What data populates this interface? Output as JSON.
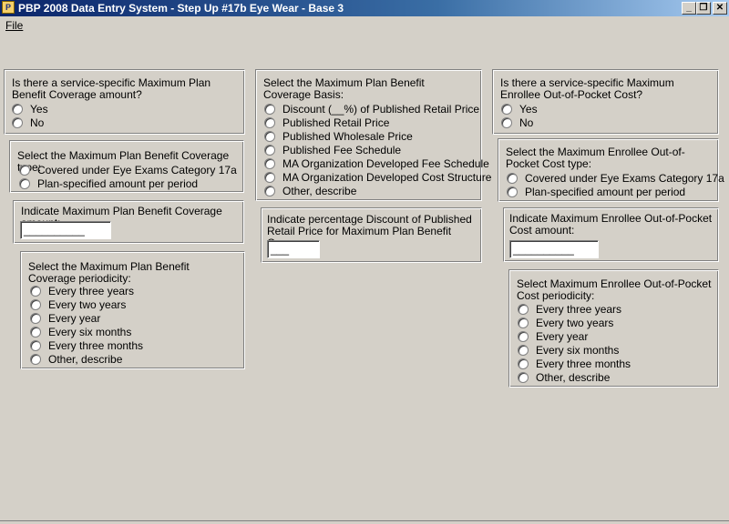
{
  "window": {
    "title": "PBP 2008 Data Entry System - Step Up #17b Eye Wear - Base 3",
    "icon": "app-icon",
    "controls": {
      "minimize": "_",
      "restore": "❐",
      "close": "✕"
    }
  },
  "menu": {
    "file": "File"
  },
  "left": {
    "q1": {
      "question": "Is there a service-specific Maximum Plan Benefit Coverage amount?",
      "options": [
        "Yes",
        "No"
      ]
    },
    "q2": {
      "question": "Select the Maximum Plan Benefit Coverage type:",
      "options": [
        "Covered under Eye Exams Category 17a",
        "Plan-specified amount per period"
      ]
    },
    "q3": {
      "question": "Indicate Maximum Plan Benefit Coverage amount:",
      "value": "__________"
    },
    "q4": {
      "question": "Select the Maximum Plan Benefit Coverage periodicity:",
      "options": [
        "Every three years",
        "Every two years",
        "Every year",
        "Every six months",
        "Every three months",
        "Other, describe"
      ]
    }
  },
  "middle": {
    "q1": {
      "question": "Select the Maximum Plan Benefit Coverage Basis:",
      "options": [
        "Discount (__%) of Published Retail Price",
        "Published Retail Price",
        "Published Wholesale Price",
        "Published Fee Schedule",
        "MA Organization Developed Fee Schedule",
        "MA Organization Developed Cost Structure",
        "Other, describe"
      ]
    },
    "q2": {
      "question": "Indicate percentage Discount of Published Retail Price for Maximum Plan Benefit Coverage:",
      "value": "___"
    }
  },
  "right": {
    "q1": {
      "question": "Is there a service-specific Maximum Enrollee Out-of-Pocket Cost?",
      "options": [
        "Yes",
        "No"
      ]
    },
    "q2": {
      "question": "Select the Maximum Enrollee Out-of-Pocket Cost type:",
      "options": [
        "Covered under Eye Exams Category 17a",
        "Plan-specified amount per period"
      ]
    },
    "q3": {
      "question": "Indicate Maximum Enrollee Out-of-Pocket Cost amount:",
      "value": "__________"
    },
    "q4": {
      "question": "Select Maximum Enrollee Out-of-Pocket Cost periodicity:",
      "options": [
        "Every three years",
        "Every two years",
        "Every year",
        "Every six months",
        "Every three months",
        "Other, describe"
      ]
    }
  }
}
